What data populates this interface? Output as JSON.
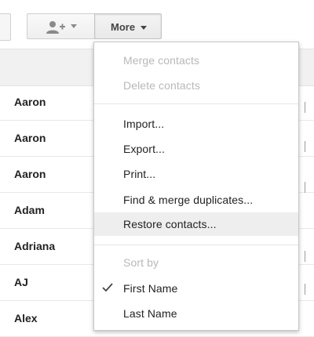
{
  "toolbar": {
    "add_contact_icon": "add-person-icon",
    "more_label": "More"
  },
  "contacts": [
    {
      "name": "Aaron"
    },
    {
      "name": "Aaron"
    },
    {
      "name": "Aaron"
    },
    {
      "name": "Adam"
    },
    {
      "name": "Adriana"
    },
    {
      "name": "AJ"
    },
    {
      "name": "Alex"
    }
  ],
  "menu": {
    "merge_contacts": "Merge contacts",
    "delete_contacts": "Delete contacts",
    "import": "Import...",
    "export": "Export...",
    "print": "Print...",
    "find_merge": "Find & merge duplicates...",
    "restore": "Restore contacts...",
    "sort_by": "Sort by",
    "first_name": "First Name",
    "last_name": "Last Name",
    "selected_sort": "First Name"
  },
  "colors": {
    "disabled_text": "#b8b8b8",
    "highlight": "#eeeeee",
    "text": "#222222"
  }
}
